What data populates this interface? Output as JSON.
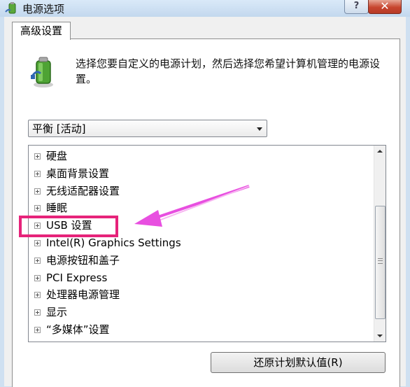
{
  "window": {
    "title": "电源选项",
    "help_label": "?",
    "close_label": "✕"
  },
  "tab": {
    "label": "高级设置"
  },
  "description": "选择您要自定义的电源计划，然后选择您希望计算机管理的电源设置。",
  "plan_select": {
    "value": "平衡 [活动]"
  },
  "tree_items": [
    {
      "label": "硬盘"
    },
    {
      "label": "桌面背景设置"
    },
    {
      "label": "无线适配器设置"
    },
    {
      "label": "睡眠"
    },
    {
      "label": "USB 设置"
    },
    {
      "label": "Intel(R) Graphics Settings"
    },
    {
      "label": "电源按钮和盖子"
    },
    {
      "label": "PCI Express"
    },
    {
      "label": "处理器电源管理"
    },
    {
      "label": "显示"
    },
    {
      "label": "“多媒体”设置"
    }
  ],
  "restore_button": {
    "label": "还原计划默认值(R)"
  },
  "colors": {
    "annotation": "#e6237a",
    "arrow": "#e84fe0",
    "close_button": "#c7462f"
  }
}
